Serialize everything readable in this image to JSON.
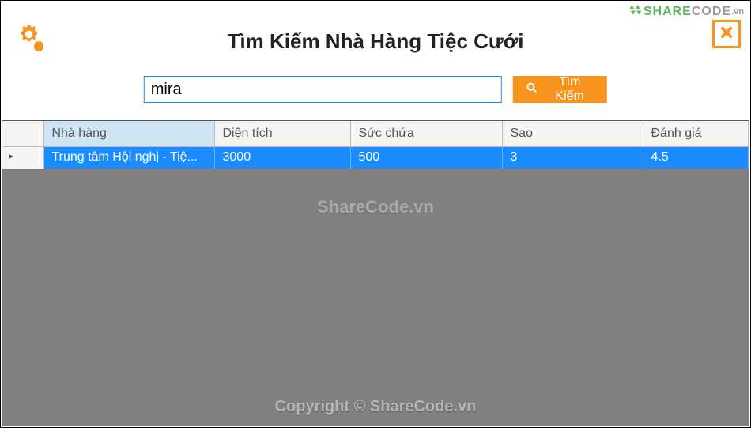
{
  "header": {
    "title": "Tìm Kiếm Nhà Hàng Tiệc Cưới",
    "logo_brand1": "SHARE",
    "logo_brand2": "CODE",
    "logo_suffix": ".vn"
  },
  "search": {
    "value": "mira",
    "button_label": "Tìm Kiếm"
  },
  "table": {
    "columns": {
      "name": "Nhà hàng",
      "area": "Diện tích",
      "capacity": "Sức chứa",
      "star": "Sao",
      "rating": "Đánh giá"
    },
    "rows": [
      {
        "name": "Trung tâm Hội nghị - Tiệ...",
        "area": "3000",
        "capacity": "500",
        "star": "3",
        "rating": "4.5"
      }
    ]
  },
  "watermarks": {
    "center": "ShareCode.vn",
    "bottom": "Copyright © ShareCode.vn"
  }
}
